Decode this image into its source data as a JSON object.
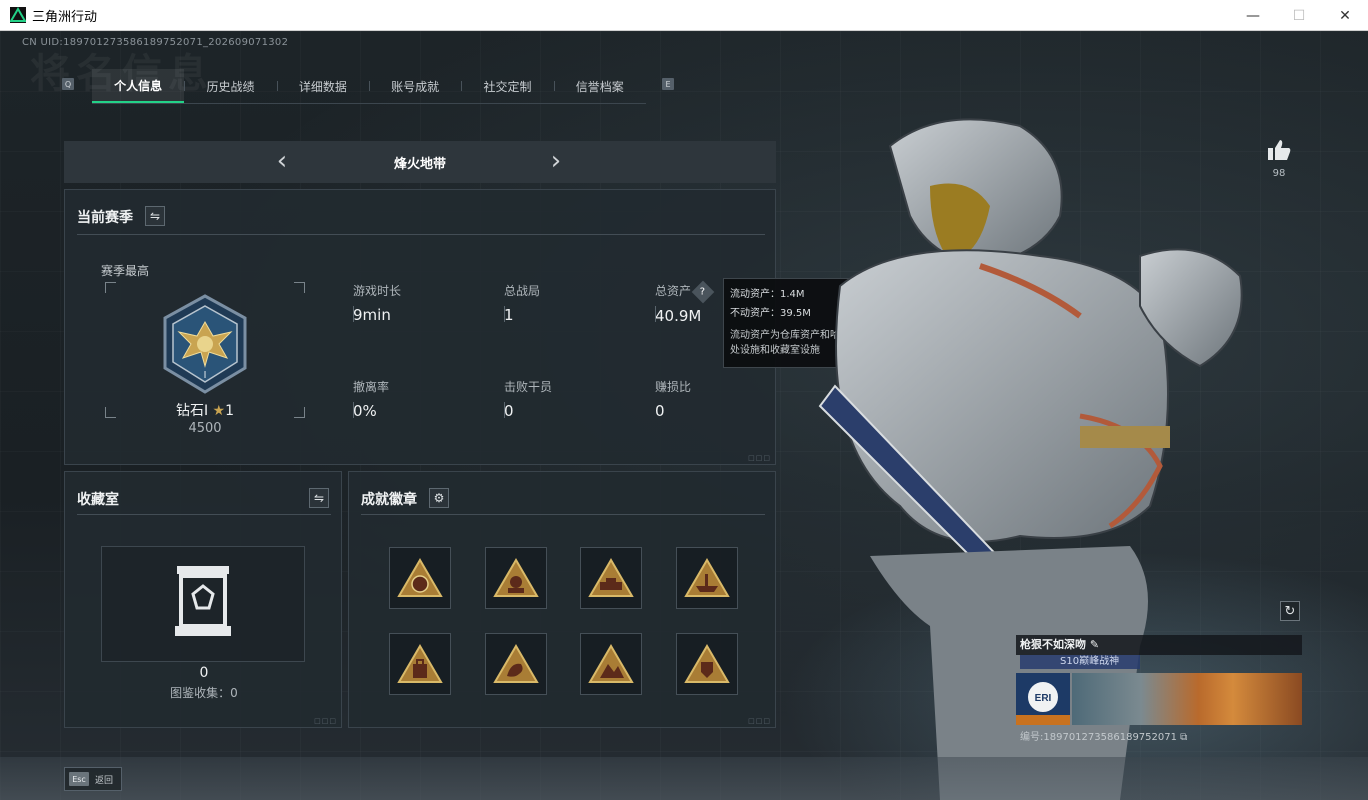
{
  "window": {
    "title": "三角洲行动"
  },
  "uid_line": "CN UID:1897012735861897520​71_202609071302",
  "watermark": "将名信息",
  "tabs": {
    "left_key": "Q",
    "right_key": "E",
    "items": [
      {
        "label": "个人信息",
        "active": true
      },
      {
        "label": "历史战绩"
      },
      {
        "label": "详细数据"
      },
      {
        "label": "账号成就"
      },
      {
        "label": "社交定制"
      },
      {
        "label": "信誉档案"
      }
    ]
  },
  "mode": {
    "title": "烽火地带"
  },
  "season": {
    "title": "当前赛季",
    "best_label": "赛季最高",
    "rank_name": "钻石I",
    "rank_stars": "1",
    "rank_score": "4500",
    "stats": [
      {
        "label": "游戏时长",
        "value": "9min"
      },
      {
        "label": "总战局",
        "value": "1"
      },
      {
        "label": "总资产",
        "value": "40.9M"
      },
      {
        "label": "撤离率",
        "value": "0%"
      },
      {
        "label": "击败干员",
        "value": "0"
      },
      {
        "label": "赚损比",
        "value": "0"
      }
    ]
  },
  "tooltip": {
    "liquid": "流动资产：1.4M",
    "fixed": "不动资产：39.5M",
    "desc": "流动资产为仓库资产和哈夫币，不动资产为特勤处设施和收藏室设施"
  },
  "collection": {
    "title": "收藏室",
    "count": "0",
    "label": "图鉴收集：0"
  },
  "badges": {
    "title": "成就徽章",
    "items": [
      "eri-icon",
      "operator-icon",
      "vehicle-icon",
      "ship-icon",
      "bag-icon",
      "dragon-icon",
      "map-icon",
      "shield-icon"
    ]
  },
  "profile": {
    "like_count": "98",
    "card_name": "枪狠不如深吻",
    "card_title": "S10巅峰战神",
    "card_id": "编号:189701273586189752071"
  },
  "footer": {
    "esc_key": "Esc",
    "esc_label": "返回"
  },
  "colors": {
    "accent": "#23d187",
    "badge_gold": "#c9a451",
    "tooltip_bg": "#0c0e10"
  }
}
